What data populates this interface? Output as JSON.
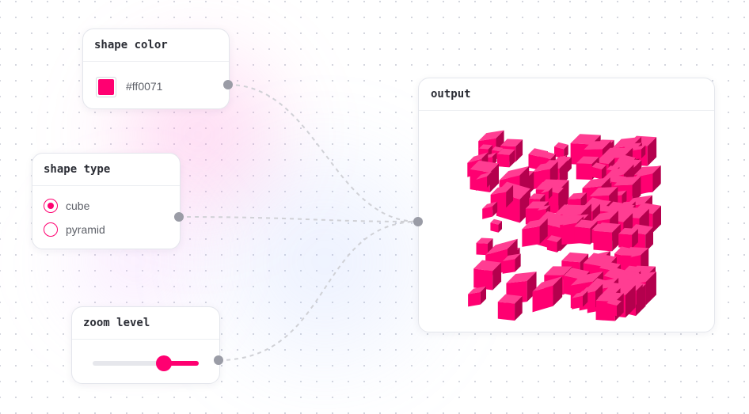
{
  "nodes": {
    "shape_color": {
      "title": "shape color",
      "value": "#ff0071",
      "swatch_color": "#ff0071"
    },
    "shape_type": {
      "title": "shape type",
      "options": [
        {
          "label": "cube",
          "selected": true
        },
        {
          "label": "pyramid",
          "selected": false
        }
      ]
    },
    "zoom_level": {
      "title": "zoom level",
      "value_fraction": 0.67
    },
    "output": {
      "title": "output",
      "shape": "cube",
      "color": "#ff0071"
    }
  },
  "colors": {
    "accent": "#ff0071",
    "port": "#9a9ca6",
    "wire": "#d0d1d6"
  }
}
